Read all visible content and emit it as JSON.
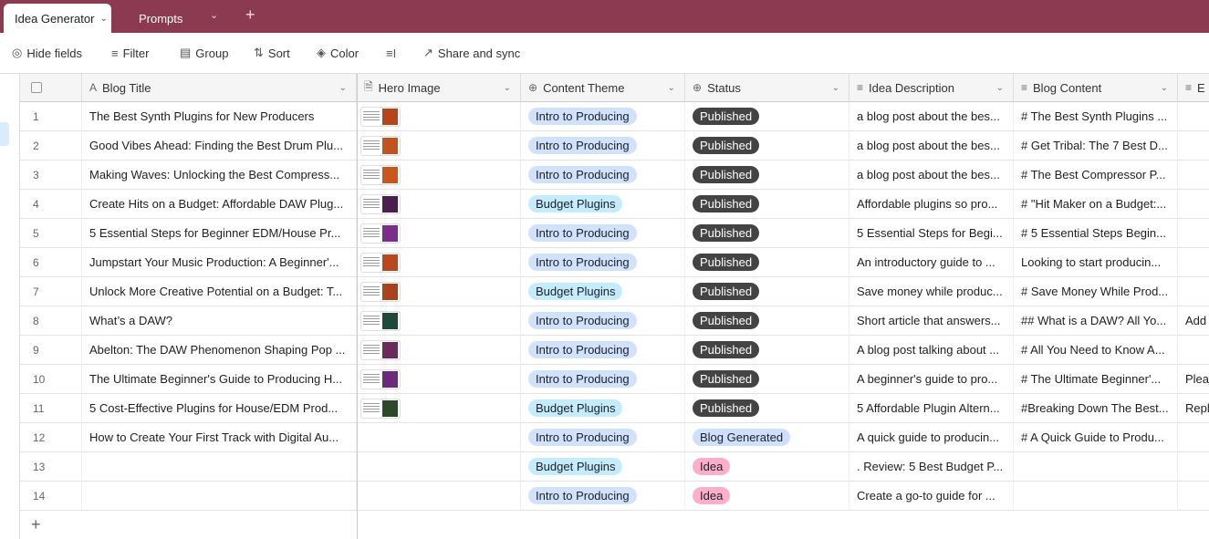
{
  "tabs": [
    {
      "label": "Idea Generator",
      "active": true
    },
    {
      "label": "Prompts",
      "active": false
    }
  ],
  "toolbar": {
    "hide_fields": "Hide fields",
    "filter": "Filter",
    "group": "Group",
    "sort": "Sort",
    "color": "Color",
    "share": "Share and sync"
  },
  "columns": [
    "Blog Title",
    "Hero Image",
    "Content Theme",
    "Status",
    "Idea Description",
    "Blog Content",
    "E"
  ],
  "colors": {
    "topbar": "#8b3a52",
    "published": "#444444",
    "idea": "#ffaec9",
    "blog_generated": "#cfdfff",
    "intro": "#d1e2ff",
    "budget": "#c4ecff"
  },
  "rows": [
    {
      "n": "1",
      "title": "The Best Synth Plugins for New Producers",
      "img": "#b5461c",
      "theme": "Intro to Producing",
      "status": "Published",
      "desc": "a blog post about the bes...",
      "content": "# The Best Synth Plugins ...",
      "extra": ""
    },
    {
      "n": "2",
      "title": "Good Vibes Ahead: Finding the Best Drum Plu...",
      "img": "#c2521f",
      "theme": "Intro to Producing",
      "status": "Published",
      "desc": "a blog post about the bes...",
      "content": "# Get Tribal: The 7 Best D...",
      "extra": ""
    },
    {
      "n": "3",
      "title": "Making Waves: Unlocking the Best Compress...",
      "img": "#c9571d",
      "theme": "Intro to Producing",
      "status": "Published",
      "desc": "a blog post about the bes...",
      "content": "# The Best Compressor P...",
      "extra": ""
    },
    {
      "n": "4",
      "title": "Create Hits on a Budget: Affordable DAW Plug...",
      "img": "#4a1f4f",
      "theme": "Budget Plugins",
      "status": "Published",
      "desc": "Affordable plugins so pro...",
      "content": "# \"Hit Maker on a Budget:...",
      "extra": ""
    },
    {
      "n": "5",
      "title": "5 Essential Steps for Beginner EDM/House Pr...",
      "img": "#7a2e8a",
      "theme": "Intro to Producing",
      "status": "Published",
      "desc": "5 Essential Steps for Begi...",
      "content": "# 5 Essential Steps Begin...",
      "extra": ""
    },
    {
      "n": "6",
      "title": "Jumpstart Your Music Production: A Beginner'...",
      "img": "#b8481e",
      "theme": "Intro to Producing",
      "status": "Published",
      "desc": "An introductory guide to ...",
      "content": "Looking to start producin...",
      "extra": ""
    },
    {
      "n": "7",
      "title": "Unlock More Creative Potential on a Budget: T...",
      "img": "#a8421c",
      "theme": "Budget Plugins",
      "status": "Published",
      "desc": "Save money while produc...",
      "content": "# Save Money While Prod...",
      "extra": ""
    },
    {
      "n": "8",
      "title": "What’s a DAW?",
      "img": "#1f4a3a",
      "theme": "Intro to Producing",
      "status": "Published",
      "desc": "Short article that answers...",
      "content": "## What is a DAW? All Yo...",
      "extra": "Add"
    },
    {
      "n": "9",
      "title": "Abelton: The DAW Phenomenon Shaping Pop ...",
      "img": "#6a2a5a",
      "theme": "Intro to Producing",
      "status": "Published",
      "desc": "A blog post talking about ...",
      "content": "# All You Need to Know A...",
      "extra": ""
    },
    {
      "n": "10",
      "title": "The Ultimate Beginner's Guide to Producing H...",
      "img": "#6b2a7a",
      "theme": "Intro to Producing",
      "status": "Published",
      "desc": "A beginner's guide to pro...",
      "content": "# The Ultimate Beginner'...",
      "extra": "Pleas"
    },
    {
      "n": "11",
      "title": "5 Cost-Effective Plugins for House/EDM Prod...",
      "img": "#2a4a2a",
      "theme": "Budget Plugins",
      "status": "Published",
      "desc": "5 Affordable Plugin Altern...",
      "content": "#Breaking Down The Best...",
      "extra": "Repl"
    },
    {
      "n": "12",
      "title": "How to Create Your First Track with Digital Au...",
      "img": "",
      "theme": "Intro to Producing",
      "status": "Blog Generated",
      "desc": "A quick guide to producin...",
      "content": "# A Quick Guide to Produ...",
      "extra": ""
    },
    {
      "n": "13",
      "title": "",
      "img": "",
      "theme": "Budget Plugins",
      "status": "Idea",
      "desc": ". Review: 5 Best Budget P...",
      "content": "",
      "extra": ""
    },
    {
      "n": "14",
      "title": "",
      "img": "",
      "theme": "Intro to Producing",
      "status": "Idea",
      "desc": "Create a go-to guide for ...",
      "content": "",
      "extra": ""
    }
  ]
}
